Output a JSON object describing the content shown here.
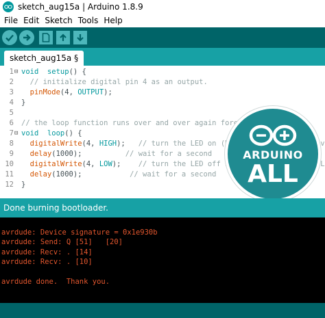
{
  "window": {
    "title": "sketch_aug15a | Arduino 1.8.9",
    "icon": "arduino-logo-icon"
  },
  "menu": [
    "File",
    "Edit",
    "Sketch",
    "Tools",
    "Help"
  ],
  "toolbar": {
    "buttons": [
      {
        "name": "verify-button",
        "icon": "checkmark-icon"
      },
      {
        "name": "upload-button",
        "icon": "arrow-right-icon"
      },
      {
        "name": "new-button",
        "icon": "new-file-icon"
      },
      {
        "name": "open-button",
        "icon": "arrow-up-icon"
      },
      {
        "name": "save-button",
        "icon": "arrow-down-icon"
      }
    ]
  },
  "tab": {
    "label": "sketch_aug15a §"
  },
  "editor": {
    "lines": [
      {
        "num": "1",
        "fold": "⊟",
        "segments": [
          [
            "kw-type",
            "void"
          ],
          [
            "",
            "  "
          ],
          [
            "kw-type",
            "setup"
          ],
          [
            "",
            "() {"
          ]
        ]
      },
      {
        "num": "2",
        "fold": "",
        "segments": [
          [
            "cm",
            "  // initialize digital pin 4 as an output."
          ]
        ]
      },
      {
        "num": "3",
        "fold": "",
        "segments": [
          [
            "",
            "  "
          ],
          [
            "kw-func",
            "pinMode"
          ],
          [
            "",
            "(4, "
          ],
          [
            "kw-const",
            "OUTPUT"
          ],
          [
            "",
            ");"
          ]
        ]
      },
      {
        "num": "4",
        "fold": "",
        "segments": [
          [
            "",
            "}"
          ]
        ]
      },
      {
        "num": "5",
        "fold": "",
        "segments": []
      },
      {
        "num": "6",
        "fold": "",
        "segments": [
          [
            "cm",
            "// the loop function runs over and over again forever"
          ]
        ]
      },
      {
        "num": "7",
        "fold": "⊟",
        "segments": [
          [
            "kw-type",
            "void"
          ],
          [
            "",
            "  "
          ],
          [
            "kw-type",
            "loop"
          ],
          [
            "",
            "() {"
          ]
        ]
      },
      {
        "num": "8",
        "fold": "",
        "segments": [
          [
            "",
            "  "
          ],
          [
            "kw-func",
            "digitalWrite"
          ],
          [
            "",
            "(4, "
          ],
          [
            "kw-const",
            "HIGH"
          ],
          [
            "",
            ");   "
          ],
          [
            "cm",
            "// turn the LED on (HIGH is the voltage level)"
          ]
        ]
      },
      {
        "num": "9",
        "fold": "",
        "segments": [
          [
            "",
            "  "
          ],
          [
            "kw-func",
            "delay"
          ],
          [
            "",
            "(1000);          "
          ],
          [
            "cm",
            "// wait for a second"
          ]
        ]
      },
      {
        "num": "10",
        "fold": "",
        "segments": [
          [
            "",
            "  "
          ],
          [
            "kw-func",
            "digitalWrite"
          ],
          [
            "",
            "(4, "
          ],
          [
            "kw-const",
            "LOW"
          ],
          [
            "",
            ");    "
          ],
          [
            "cm",
            "// turn the LED off by making the voltage LOW"
          ]
        ]
      },
      {
        "num": "11",
        "fold": "",
        "segments": [
          [
            "",
            "  "
          ],
          [
            "kw-func",
            "delay"
          ],
          [
            "",
            "(1000);           "
          ],
          [
            "cm",
            "// wait for a second"
          ]
        ]
      },
      {
        "num": "12",
        "fold": "",
        "segments": [
          [
            "",
            "}"
          ]
        ]
      }
    ]
  },
  "badge": {
    "name": "ARDUINO",
    "sub": "ALL"
  },
  "status": {
    "text": "Done burning bootloader."
  },
  "console": {
    "lines": [
      "",
      "avrdude: Device signature = 0x1e930b",
      "avrdude: Send: Q [51]   [20]",
      "avrdude: Recv: . [14]",
      "avrdude: Recv: . [10]",
      "",
      "avrdude done.  Thank you."
    ]
  },
  "colors": {
    "toolbar": "#006468",
    "tabbar": "#17a1a5",
    "console_text": "#e4572e",
    "badge": "#1f8b91"
  }
}
